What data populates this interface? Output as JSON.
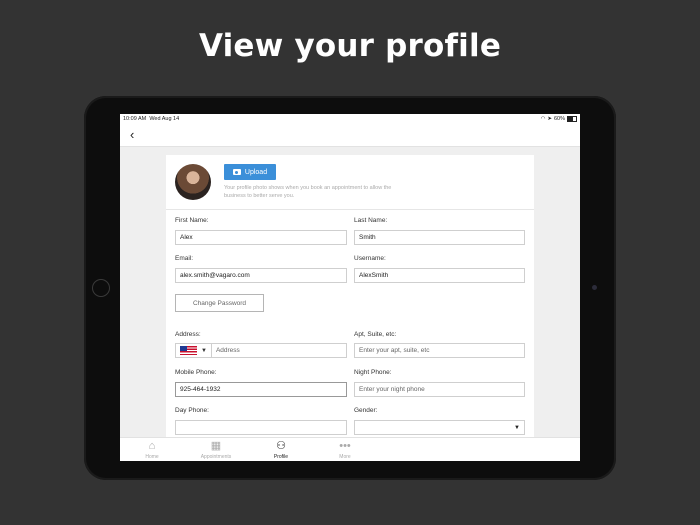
{
  "headline": "View your profile",
  "status": {
    "time": "10:09 AM",
    "date": "Wed Aug 14",
    "battery": "60%"
  },
  "profile_photo": {
    "upload_label": "Upload",
    "note": "Your profile photo shows when you book an appointment to allow the business to better serve you."
  },
  "form": {
    "first_name": {
      "label": "First Name:",
      "value": "Alex"
    },
    "last_name": {
      "label": "Last Name:",
      "value": "Smith"
    },
    "email": {
      "label": "Email:",
      "value": "alex.smith@vagaro.com"
    },
    "username": {
      "label": "Username:",
      "value": "AlexSmith"
    },
    "change_password": "Change Password",
    "address": {
      "label": "Address:",
      "placeholder": "Address"
    },
    "apt": {
      "label": "Apt, Suite, etc:",
      "placeholder": "Enter your apt, suite, etc"
    },
    "mobile_phone": {
      "label": "Mobile Phone:",
      "value": "925-464-1932"
    },
    "night_phone": {
      "label": "Night Phone:",
      "placeholder": "Enter your night phone"
    },
    "day_phone": {
      "label": "Day Phone:",
      "value": ""
    },
    "gender": {
      "label": "Gender:",
      "value": ""
    }
  },
  "tabs": [
    {
      "label": "Home",
      "icon": "home-icon",
      "active": false
    },
    {
      "label": "Appointments",
      "icon": "calendar-icon",
      "active": false
    },
    {
      "label": "Profile",
      "icon": "user-icon",
      "active": true
    },
    {
      "label": "More",
      "icon": "more-icon",
      "active": false
    }
  ],
  "colors": {
    "accent": "#3b8fd9",
    "background": "#333333"
  }
}
